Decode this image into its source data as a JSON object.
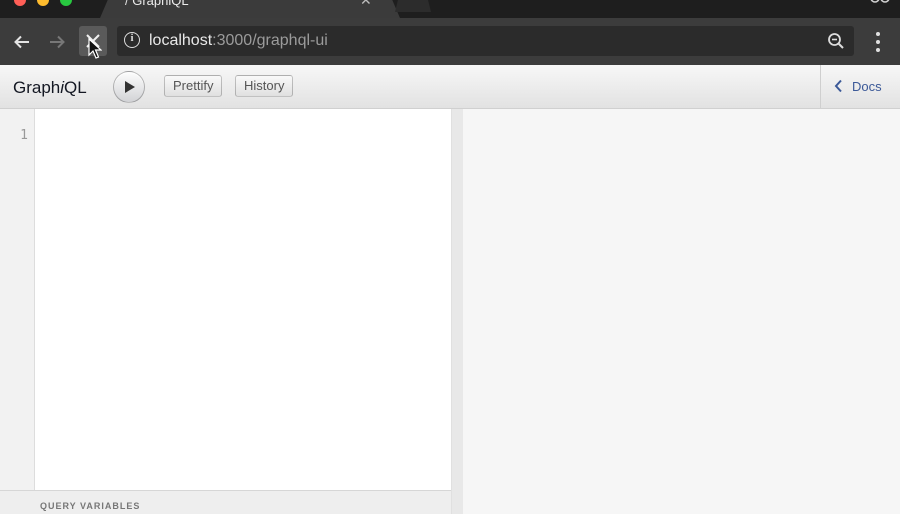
{
  "browser": {
    "tab_title": "GraphiQL",
    "url_host": "localhost",
    "url_rest": ":3000/graphql-ui"
  },
  "graphiql": {
    "title_prefix": "Graph",
    "title_italic": "i",
    "title_suffix": "QL",
    "prettify_label": "Prettify",
    "history_label": "History",
    "docs_label": "Docs",
    "line_number": "1",
    "query_variables_label": "QUERY VARIABLES",
    "docs_color": "#3B5998"
  },
  "icons": [
    "back-arrow-icon",
    "forward-arrow-icon",
    "stop-icon",
    "info-icon",
    "zoom-icon",
    "more-menu-icon",
    "play-icon",
    "chevron-left-icon",
    "cursor-pointer-icon",
    "profile-icon",
    "tab-close-icon"
  ]
}
